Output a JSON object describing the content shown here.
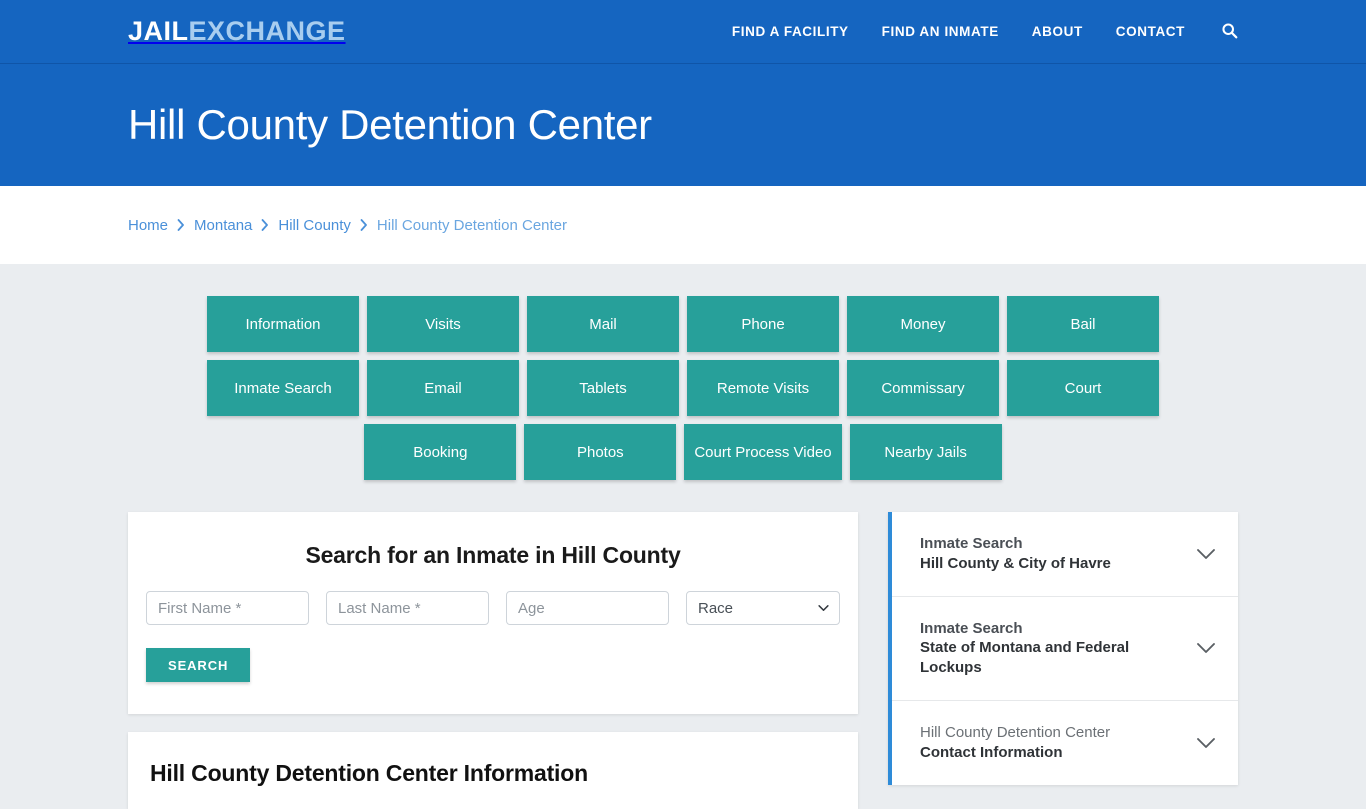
{
  "header": {
    "logo_primary": "JAIL",
    "logo_secondary": "EXCHANGE",
    "nav": [
      {
        "label": "FIND A FACILITY"
      },
      {
        "label": "FIND AN INMATE"
      },
      {
        "label": "ABOUT"
      },
      {
        "label": "CONTACT"
      }
    ],
    "search_icon": "search-icon",
    "brand_color": "#1565c0"
  },
  "hero": {
    "title": "Hill County Detention Center"
  },
  "breadcrumb": {
    "items": [
      {
        "label": "Home"
      },
      {
        "label": "Montana"
      },
      {
        "label": "Hill County"
      },
      {
        "label": "Hill County Detention Center"
      }
    ],
    "separator": "›"
  },
  "nav_grid": {
    "accent_color": "#27a09a",
    "row1": [
      {
        "label": "Information"
      },
      {
        "label": "Visits"
      },
      {
        "label": "Mail"
      },
      {
        "label": "Phone"
      },
      {
        "label": "Money"
      },
      {
        "label": "Bail"
      },
      {
        "label": "Inmate Search"
      }
    ],
    "row2": [
      {
        "label": "Email"
      },
      {
        "label": "Tablets"
      },
      {
        "label": "Remote Visits"
      },
      {
        "label": "Commissary"
      },
      {
        "label": "Court"
      },
      {
        "label": "Booking"
      },
      {
        "label": "Photos"
      }
    ],
    "row3": [
      {
        "label": "Court Process Video"
      },
      {
        "label": "Nearby Jails"
      }
    ]
  },
  "search_form": {
    "heading": "Search for an Inmate in Hill County",
    "first_name_placeholder": "First Name *",
    "last_name_placeholder": "Last Name *",
    "age_placeholder": "Age",
    "first_name_value": "",
    "last_name_value": "",
    "age_value": "",
    "race_selected": "Race",
    "race_options": [
      "Race"
    ],
    "submit_label": "SEARCH"
  },
  "info_section": {
    "heading": "Hill County Detention Center Information"
  },
  "sidebar": {
    "accent_color": "#2e8bd8",
    "panels": [
      {
        "line1": "Inmate Search",
        "line2": "Hill County & City of Havre",
        "style": "bold",
        "chevron": "chevron-down-icon"
      },
      {
        "line1": "Inmate Search",
        "line2": "State of Montana and Federal Lockups",
        "style": "bold",
        "chevron": "chevron-down-icon"
      },
      {
        "line1": "Hill County Detention Center",
        "line2": "Contact Information",
        "style": "alt",
        "chevron": "chevron-down-icon"
      }
    ]
  }
}
